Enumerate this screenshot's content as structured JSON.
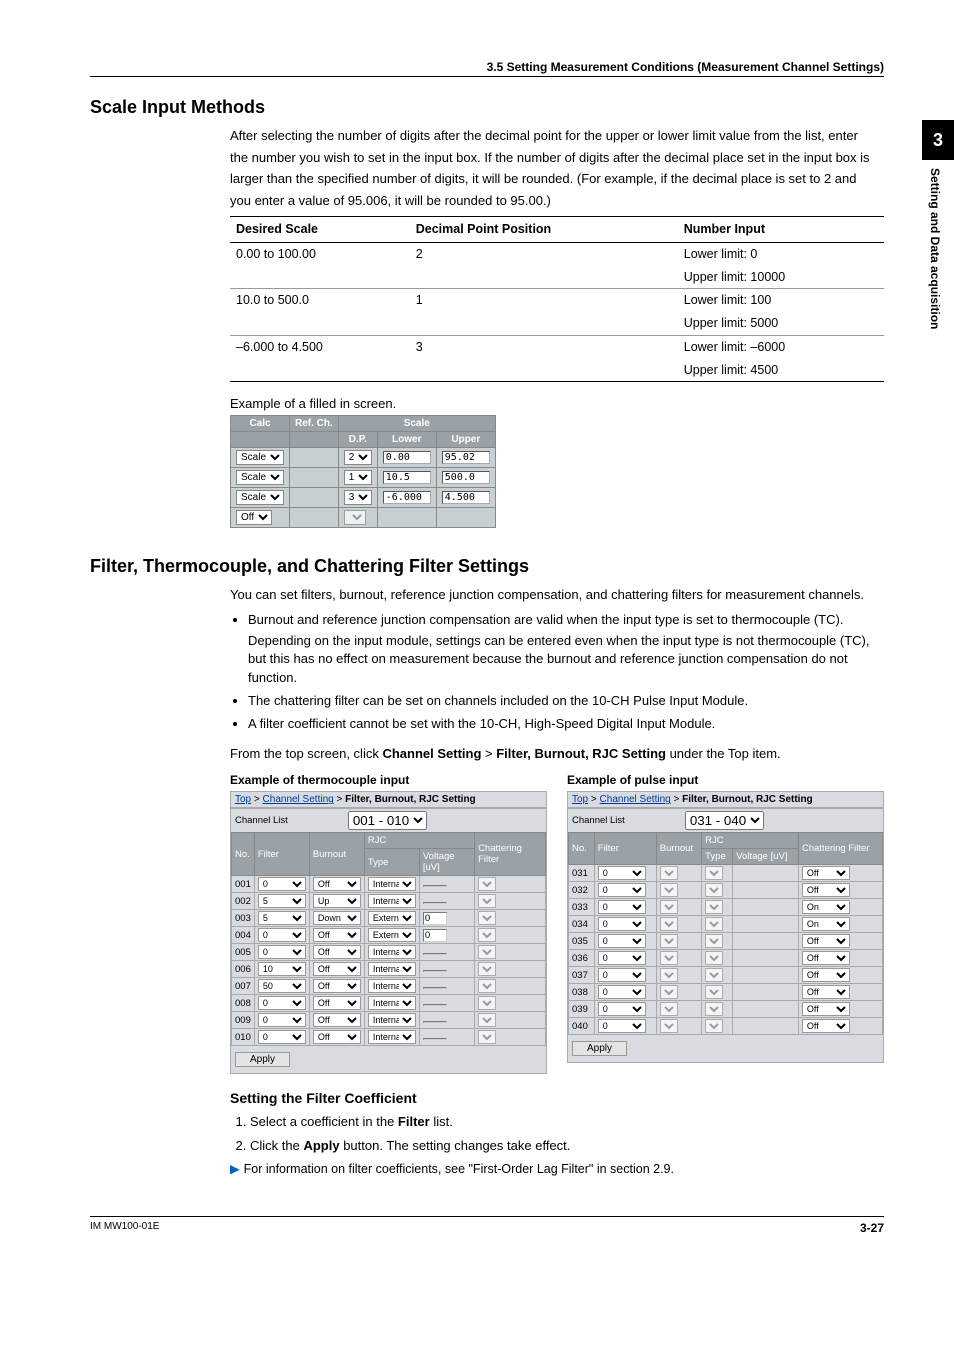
{
  "section_header": "3.5  Setting Measurement Conditions (Measurement Channel Settings)",
  "side_tab": {
    "num": "3",
    "text": "Setting and Data acquisition"
  },
  "h_scale": "Scale Input Methods",
  "scale_intro": [
    "After selecting the number of digits after the decimal point for the upper or lower limit value from the list, enter",
    "the number you wish to set in the input box. If the number of digits after the decimal place set in the input box is",
    "larger than the specified number of digits, it will be rounded. (For example, if the decimal place is set to 2 and",
    "you enter a value of 95.006, it will be rounded to 95.00.)"
  ],
  "scale_table": {
    "headers": [
      "Desired Scale",
      "Decimal Point Position",
      "Number Input"
    ],
    "rows": [
      {
        "scale": "0.00 to 100.00",
        "dp": "2",
        "lower": "Lower limit: 0",
        "upper": "Upper limit: 10000"
      },
      {
        "scale": "10.0 to 500.0",
        "dp": "1",
        "lower": "Lower limit: 100",
        "upper": "Upper limit: 5000"
      },
      {
        "scale": "–6.000 to 4.500",
        "dp": "3",
        "lower": "Lower limit: –6000",
        "upper": "Upper limit: 4500"
      }
    ]
  },
  "example_caption": "Example of a filled in screen.",
  "mini": {
    "cols": [
      "Calc",
      "Ref. Ch.",
      "Scale",
      "",
      ""
    ],
    "sub": [
      "",
      "",
      "D.P.",
      "Lower",
      "Upper"
    ],
    "rows": [
      {
        "calc": "Scale",
        "dp": "2",
        "lower": "0.00",
        "upper": "95.02"
      },
      {
        "calc": "Scale",
        "dp": "1",
        "lower": "10.5",
        "upper": "500.0"
      },
      {
        "calc": "Scale",
        "dp": "3",
        "lower": "-6.000",
        "upper": "4.500"
      },
      {
        "calc": "Off",
        "dp": "",
        "lower": "",
        "upper": ""
      }
    ]
  },
  "h_filter": "Filter, Thermocouple, and Chattering Filter Settings",
  "filter_intro": "You can set filters, burnout, reference junction compensation, and chattering filters for measurement channels.",
  "bullets": [
    {
      "main": "Burnout and reference junction compensation are valid when the input type is set to thermocouple (TC).",
      "sub": "Depending on the input module, settings can be entered even when the input type is not thermocouple (TC), but this has no effect on measurement because the burnout and reference junction compensation do not function."
    },
    {
      "main": "The chattering filter can be set on channels included on the 10-CH Pulse Input Module."
    },
    {
      "main": "A filter coefficient cannot be set with the 10-CH, High-Speed Digital Input Module."
    }
  ],
  "from_top": {
    "pre": "From the top screen, click ",
    "b1": "Channel Setting",
    "mid": " > ",
    "b2": "Filter, Burnout, RJC Setting",
    "post": " under the Top item."
  },
  "col_tc_title": "Example of thermocouple input",
  "col_pulse_title": "Example of pulse input",
  "breadcrumb": {
    "a1": "Top",
    "a2": "Channel Setting",
    "tail": "Filter, Burnout, RJC Setting"
  },
  "ch_list_label": "Channel List",
  "tc_range": "001 - 010",
  "pulse_range": "031 - 040",
  "ch_headers": {
    "no": "No.",
    "filter": "Filter",
    "burnout": "Burnout",
    "rjc": "RJC",
    "type": "Type",
    "voltage": "Voltage [uV]",
    "chat": "Chattering Filter"
  },
  "tc_rows": [
    {
      "no": "001",
      "filter": "0",
      "burnout": "Off",
      "type": "Internal",
      "volt": "",
      "chat": ""
    },
    {
      "no": "002",
      "filter": "5",
      "burnout": "Up",
      "type": "Internal",
      "volt": "",
      "chat": ""
    },
    {
      "no": "003",
      "filter": "5",
      "burnout": "Down",
      "type": "External",
      "volt": "0",
      "chat": ""
    },
    {
      "no": "004",
      "filter": "0",
      "burnout": "Off",
      "type": "External",
      "volt": "0",
      "chat": ""
    },
    {
      "no": "005",
      "filter": "0",
      "burnout": "Off",
      "type": "Internal",
      "volt": "",
      "chat": ""
    },
    {
      "no": "006",
      "filter": "10",
      "burnout": "Off",
      "type": "Internal",
      "volt": "",
      "chat": ""
    },
    {
      "no": "007",
      "filter": "50",
      "burnout": "Off",
      "type": "Internal",
      "volt": "",
      "chat": ""
    },
    {
      "no": "008",
      "filter": "0",
      "burnout": "Off",
      "type": "Internal",
      "volt": "",
      "chat": ""
    },
    {
      "no": "009",
      "filter": "0",
      "burnout": "Off",
      "type": "Internal",
      "volt": "",
      "chat": ""
    },
    {
      "no": "010",
      "filter": "0",
      "burnout": "Off",
      "type": "Internal",
      "volt": "",
      "chat": ""
    }
  ],
  "pulse_rows": [
    {
      "no": "031",
      "filter": "0",
      "chat": "Off"
    },
    {
      "no": "032",
      "filter": "0",
      "chat": "Off"
    },
    {
      "no": "033",
      "filter": "0",
      "chat": "On"
    },
    {
      "no": "034",
      "filter": "0",
      "chat": "On"
    },
    {
      "no": "035",
      "filter": "0",
      "chat": "Off"
    },
    {
      "no": "036",
      "filter": "0",
      "chat": "Off"
    },
    {
      "no": "037",
      "filter": "0",
      "chat": "Off"
    },
    {
      "no": "038",
      "filter": "0",
      "chat": "Off"
    },
    {
      "no": "039",
      "filter": "0",
      "chat": "Off"
    },
    {
      "no": "040",
      "filter": "0",
      "chat": "Off"
    }
  ],
  "apply_label": "Apply",
  "h_setting_fc": "Setting the Filter Coefficient",
  "steps": [
    {
      "pre": "Select a coefficient in the ",
      "b": "Filter",
      "post": " list."
    },
    {
      "pre": "Click the ",
      "b": "Apply",
      "post": " button. The setting changes take effect."
    }
  ],
  "note": "For information on filter coefficients, see \"First-Order Lag Filter\" in section 2.9.",
  "footer": {
    "left": "IM MW100-01E",
    "right": "3-27"
  }
}
